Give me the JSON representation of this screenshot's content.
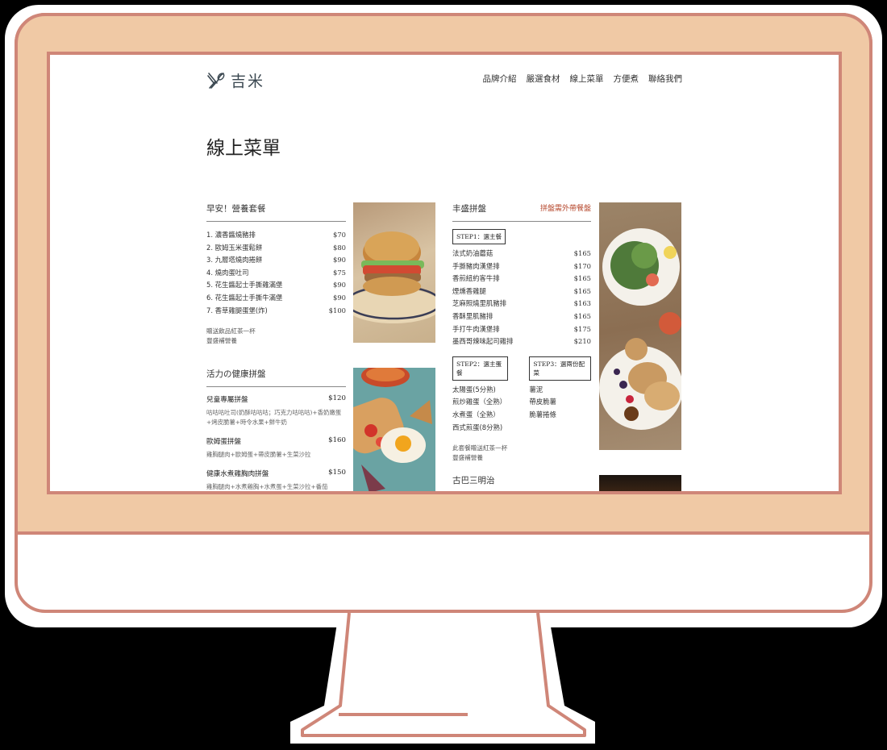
{
  "brand": {
    "name": "吉米"
  },
  "nav": {
    "items": [
      "品牌介紹",
      "嚴選食材",
      "線上菜單",
      "方便煮",
      "聯絡我們"
    ]
  },
  "page": {
    "title": "線上菜單"
  },
  "breakfast": {
    "title": "早安！營養套餐",
    "items": [
      {
        "name": "1. 濃香醬燒豬排",
        "price": "$70"
      },
      {
        "name": "2. 歐姆玉米蛋鬆餅",
        "price": "$80"
      },
      {
        "name": "3. 九層塔燒肉捲餅",
        "price": "$90"
      },
      {
        "name": "4. 燒肉蛋吐司",
        "price": "$75"
      },
      {
        "name": "5. 花生醬起士手撕雞滿堡",
        "price": "$90"
      },
      {
        "name": "6. 花生醬起士手撕牛滿堡",
        "price": "$90"
      },
      {
        "name": "7. 香草雞腿蛋堡(炸)",
        "price": "$100"
      }
    ],
    "notes": [
      "贈送飲品紅茶一杯",
      "豐盛補營養"
    ]
  },
  "healthy": {
    "title": "活力の健康拼盤",
    "items": [
      {
        "name": "兒童專屬拼盤",
        "price": "$120",
        "desc": "咕咕咕吐司(奶酥咕咕咕；巧克力咕咕咕)+香奶嫩蛋+烤皮脆薯+時令水果+鮮牛奶"
      },
      {
        "name": "歐姆蛋拼盤",
        "price": "$160",
        "desc": "雞胸腿肉+歐姆蛋+帶皮脆薯+生菜沙拉"
      },
      {
        "name": "健康水煮雞胸肉拼盤",
        "price": "$150",
        "desc": "雞胸腿肉+水煮雞胸+水煮蛋+生菜沙拉+番茄"
      }
    ]
  },
  "platter": {
    "title": "丰盛拼盤",
    "note": "拼盤需外帶餐盤",
    "step1": "STEP1：選主餐",
    "step1_items": [
      {
        "name": "法式奶油蘑菇",
        "price": "$165"
      },
      {
        "name": "手撕豬肉漢堡排",
        "price": "$170"
      },
      {
        "name": "香煎紐約客牛排",
        "price": "$165"
      },
      {
        "name": "煙燻香雞腿",
        "price": "$165"
      },
      {
        "name": "芝麻照燒里肌豬排",
        "price": "$163"
      },
      {
        "name": "香酥里肌豬排",
        "price": "$165"
      },
      {
        "name": "手打牛肉漢堡排",
        "price": "$175"
      },
      {
        "name": "墨西哥辣味起司雞排",
        "price": "$210"
      }
    ],
    "step2": "STEP2：選主蛋餐",
    "step2_items": [
      "太陽蛋(5分熟)",
      "煎炒雞蛋（全熟）",
      "水煮蛋（全熟）",
      "西式煎蛋(8分熟)"
    ],
    "step3": "STEP3：選兩份配菜",
    "step3_items": [
      "薯泥",
      "帶皮脆薯",
      "脆薯捲條"
    ],
    "notes": [
      "此套餐贈送紅茶一杯",
      "豐盛補營養"
    ]
  },
  "sandwich": {
    "title": "古巴三明治"
  }
}
